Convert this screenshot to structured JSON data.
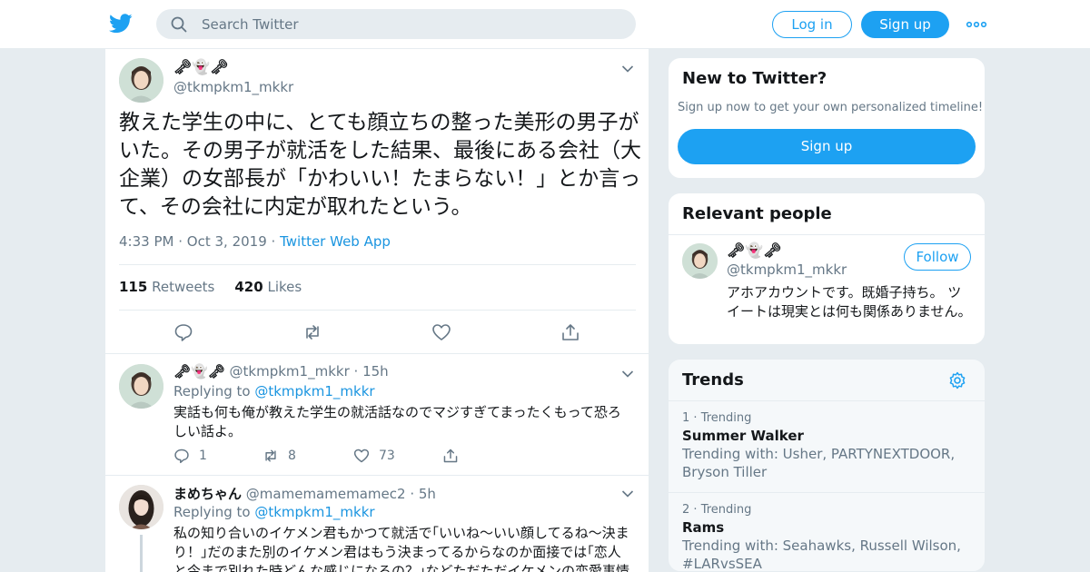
{
  "header": {
    "search_placeholder": "Search Twitter",
    "login_label": "Log in",
    "signup_label": "Sign up"
  },
  "main_tweet": {
    "display_name": "🗝👻🗝",
    "handle": "@tkmpkm1_mkkr",
    "text": "教えた学生の中に、とても顔立ちの整った美形の男子がいた。その男子が就活をした結果、最後にある会社（大企業）の女部長が「かわいい！たまらない！」とか言って、その会社に内定が取れたという。",
    "time": "4:33 PM",
    "date": "Oct 3, 2019",
    "source": "Twitter Web App",
    "retweets_count": "115",
    "retweets_label": "Retweets",
    "likes_count": "420",
    "likes_label": "Likes"
  },
  "replies": [
    {
      "display_name": "🗝👻🗝",
      "handle": "@tkmpkm1_mkkr",
      "time": "15h",
      "replying_prefix": "Replying to",
      "replying_to": "@tkmpkm1_mkkr",
      "text": "実話も何も俺が教えた学生の就活話なのでマジすぎてまったくもって恐ろしい話よ。",
      "reply_count": "1",
      "retweet_count": "8",
      "like_count": "73"
    },
    {
      "display_name": "まめちゃん",
      "handle": "@mamemamemamec2",
      "time": "5h",
      "replying_prefix": "Replying to",
      "replying_to": "@tkmpkm1_mkkr",
      "text": "私の知り合いのイケメン君もかつて就活で｢いいね〜いい顔してるね〜決まり！｣だのまた別のイケメン君はもう決まってるからなのか面接では｢恋人と今まで別れた時どんな感じになるの？｣などただただイケメンの恋愛事情"
    }
  ],
  "sidebar": {
    "new_title": "New to Twitter?",
    "new_subtitle": "Sign up now to get your own personalized timeline!",
    "new_signup": "Sign up",
    "relevant_title": "Relevant people",
    "person_name": "🗝👻🗝",
    "person_handle": "@tkmpkm1_mkkr",
    "follow_label": "Follow",
    "person_bio": "アホアカウントです。既婚子持ち。 ツイートは現実とは何も関係ありません。",
    "trends_title": "Trends",
    "trends": [
      {
        "rank": "1",
        "rank_label": "Trending",
        "name": "Summer Walker",
        "with": "Trending with: Usher, PARTYNEXTDOOR, Bryson Tiller"
      },
      {
        "rank": "2",
        "rank_label": "Trending",
        "name": "Rams",
        "with": "Trending with: Seahawks, Russell Wilson, #LARvsSEA"
      }
    ]
  },
  "colors": {
    "accent": "#1da1f2",
    "link": "#1b95e0",
    "muted": "#657786",
    "background": "#e6ecf0"
  }
}
